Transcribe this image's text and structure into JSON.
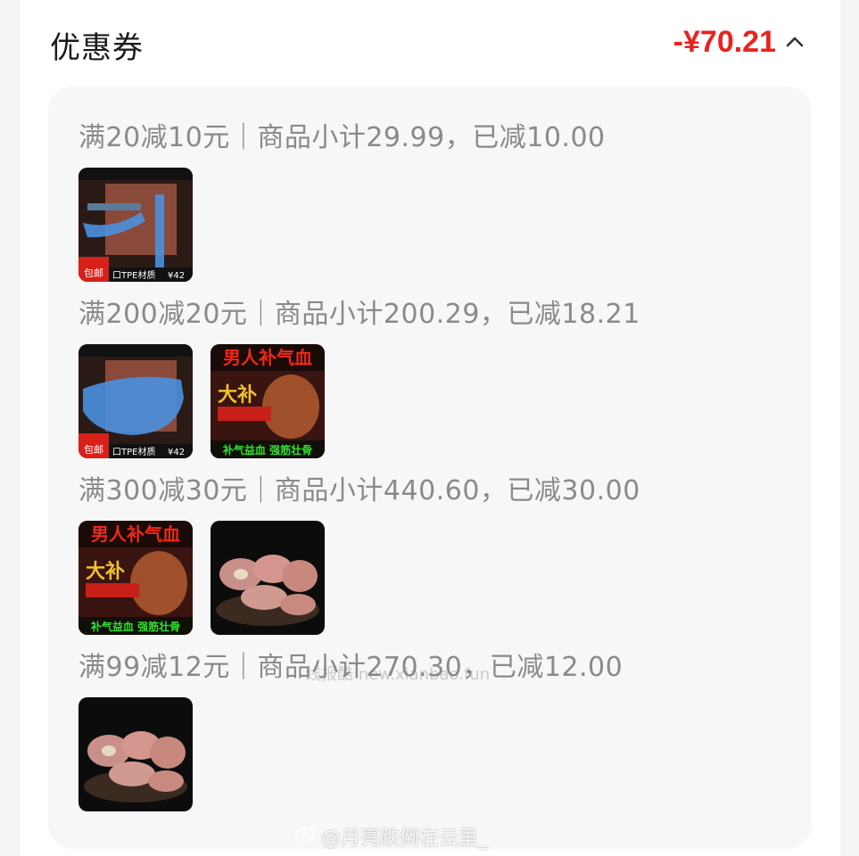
{
  "header": {
    "title": "优惠券",
    "total": "-¥70.21",
    "chevron_icon": "chevron-up-icon"
  },
  "groups": [
    {
      "label": "满20减10元｜商品小计29.99，已减10.00",
      "products": [
        {
          "image": "fitness-product-thumbnail",
          "badge": "包邮",
          "caption": "口TPE材质",
          "price": "¥42"
        }
      ]
    },
    {
      "label": "满200减20元｜商品小计200.29，已减18.21",
      "products": [
        {
          "image": "fitness-product-thumbnail",
          "badge": "包邮",
          "caption": "口TPE材质",
          "price": "¥42"
        },
        {
          "image": "supplement-product-thumbnail",
          "headline": "男人补气血",
          "big": "大补",
          "footer": "补气益血 强筋壮骨"
        }
      ]
    },
    {
      "label": "满300减30元｜商品小计440.60，已减30.00",
      "products": [
        {
          "image": "supplement-product-thumbnail",
          "headline": "男人补气血",
          "big": "大补",
          "footer": "补气益血 强筋壮骨"
        },
        {
          "image": "meat-slices-thumbnail"
        }
      ]
    },
    {
      "label": "满99减12元｜商品小计270.30，已减12.00",
      "products": [
        {
          "image": "meat-slices-thumbnail"
        }
      ]
    }
  ],
  "watermarks": {
    "middle": "线报酷 new.xianbao.fun",
    "bottom": "@月亮跌倒在云里_"
  },
  "colors": {
    "price_red": "#e8231f",
    "label_gray": "#8a8a8a",
    "panel_bg": "#f7f7f7"
  }
}
